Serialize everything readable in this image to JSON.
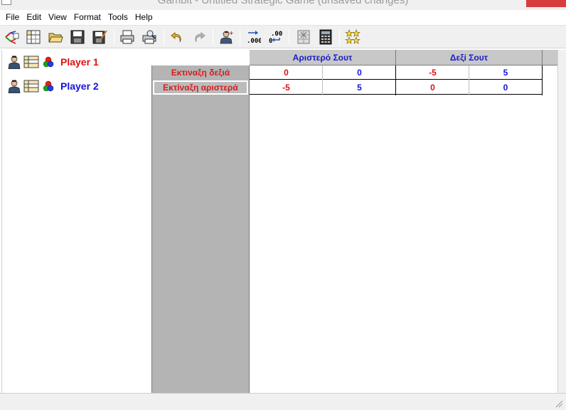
{
  "window": {
    "title": "Gambit - Untitled Strategic Game (unsaved changes)"
  },
  "menu": [
    "File",
    "Edit",
    "View",
    "Format",
    "Tools",
    "Help"
  ],
  "toolbar": {
    "buttons": [
      {
        "name": "extensive-form-icon"
      },
      {
        "name": "new-strategic-game-icon"
      },
      {
        "name": "open-icon"
      },
      {
        "name": "save-icon"
      },
      {
        "name": "save-as-icon"
      },
      {
        "name": "print-icon"
      },
      {
        "name": "print-preview-icon"
      },
      {
        "name": "undo-icon"
      },
      {
        "name": "redo-icon"
      },
      {
        "name": "add-player-icon"
      },
      {
        "name": "decimal-places-increase-icon"
      },
      {
        "name": "decimal-places-decrease-icon"
      },
      {
        "name": "dominance-icon"
      },
      {
        "name": "compute-equilibria-icon"
      },
      {
        "name": "profiles-icon"
      }
    ]
  },
  "players": [
    {
      "name": "Player 1",
      "color": "#e01010"
    },
    {
      "name": "Player 2",
      "color": "#1414d8"
    }
  ],
  "game_table": {
    "columns": [
      "Αριστερό Σουτ",
      "Δεξί Σουτ"
    ],
    "rows": [
      {
        "label": "Εκτιναξη δεξιά",
        "payoffs": [
          "0",
          "0",
          "-5",
          "5"
        ]
      },
      {
        "label": "Εκτίναξη αριστερά",
        "payoffs": [
          "-5",
          "5",
          "0",
          "0"
        ]
      }
    ]
  },
  "colors": {
    "player1": "#e01010",
    "player2": "#1414d8",
    "header_bg": "#c8c8c8",
    "row_header_bg": "#b4b4b4"
  }
}
